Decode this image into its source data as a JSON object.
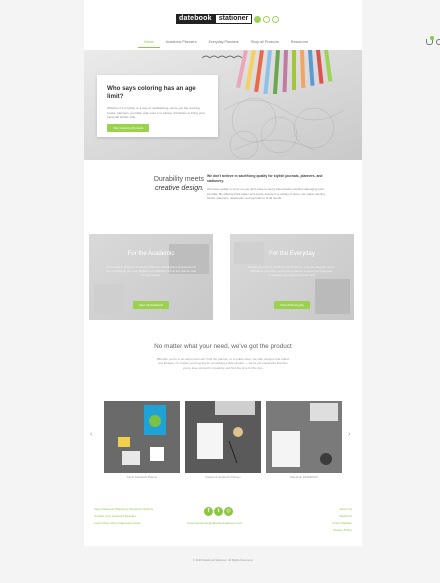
{
  "brand": {
    "logo_part1": "datebook",
    "logo_part2": "stationer",
    "accent_color": "#8dc63f"
  },
  "nav": {
    "items": [
      "Home",
      "Academic Planners",
      "Everyday Planners",
      "Shop all Products",
      "Resources"
    ],
    "active_index": 0,
    "cart_icon": "cart-icon",
    "search_icon": "search-icon"
  },
  "hero": {
    "title": "Who says coloring has an age limit?",
    "text": "Whether it's a hobby or a way of multitasking, we've got the coloring books, planners, journals, and more in a variety of finishes to bring your personal artistic side.",
    "button": "Visit Coloring Products"
  },
  "durability": {
    "title_line1": "Durability meets",
    "title_line2": "creative design.",
    "lead": "We don't believe in sacrificing quality for stylish journals, planners, and stationery.",
    "text": "We know quality is more so you don't have to worry about basic overflow damaging your journals. By offering thick paper and sturdy covers in a variety of sizes, we make coloring books, planners, notebooks, and journals to fit all needs."
  },
  "cards": [
    {
      "title": "For the Academic",
      "text": "From student planners to teacher planners, Datebook is guaranteed to get you through the year. Browse our collection to find the planner that fits your needs.",
      "button": "View All Academic"
    },
    {
      "title": "For the Everyday",
      "text": "Maybe you need a month-to-month plan or a simple calendar layout. Whatever your style, we've got a planner to keep you organized, motivated, and inspired all year long.",
      "button": "View All Everyday"
    }
  ],
  "matter": {
    "title": "No matter what your need, we've got the product",
    "text": "Whether you're in an airport and can't find the planner, or a coffee shop, we offer designs that reflect any lifestyle. Or maybe you're going for something a little simpler — we've got notebooks that free you to lose yourself in creativity and find the time for the tips."
  },
  "products": [
    {
      "label": "Junior Datebook Planner"
    },
    {
      "label": "Datebook Academic Planner"
    },
    {
      "label": "Datebook DATEBOOK"
    }
  ],
  "footer": {
    "links_left": [
      "View Datebook Stationery Checkout Options",
      "Contact your preferred Reseller",
      "Learn More About Datebook Inside"
    ],
    "social_icons": [
      "facebook-icon",
      "twitter-icon",
      "instagram-icon"
    ],
    "email": "customerservice@datebookstationer.com",
    "links_right": [
      "About Us",
      "Media Kit",
      "Find a Retailer",
      "Privacy Policy"
    ],
    "copyright": "© 2019 Datebook Stationer. All Rights Reserved."
  }
}
